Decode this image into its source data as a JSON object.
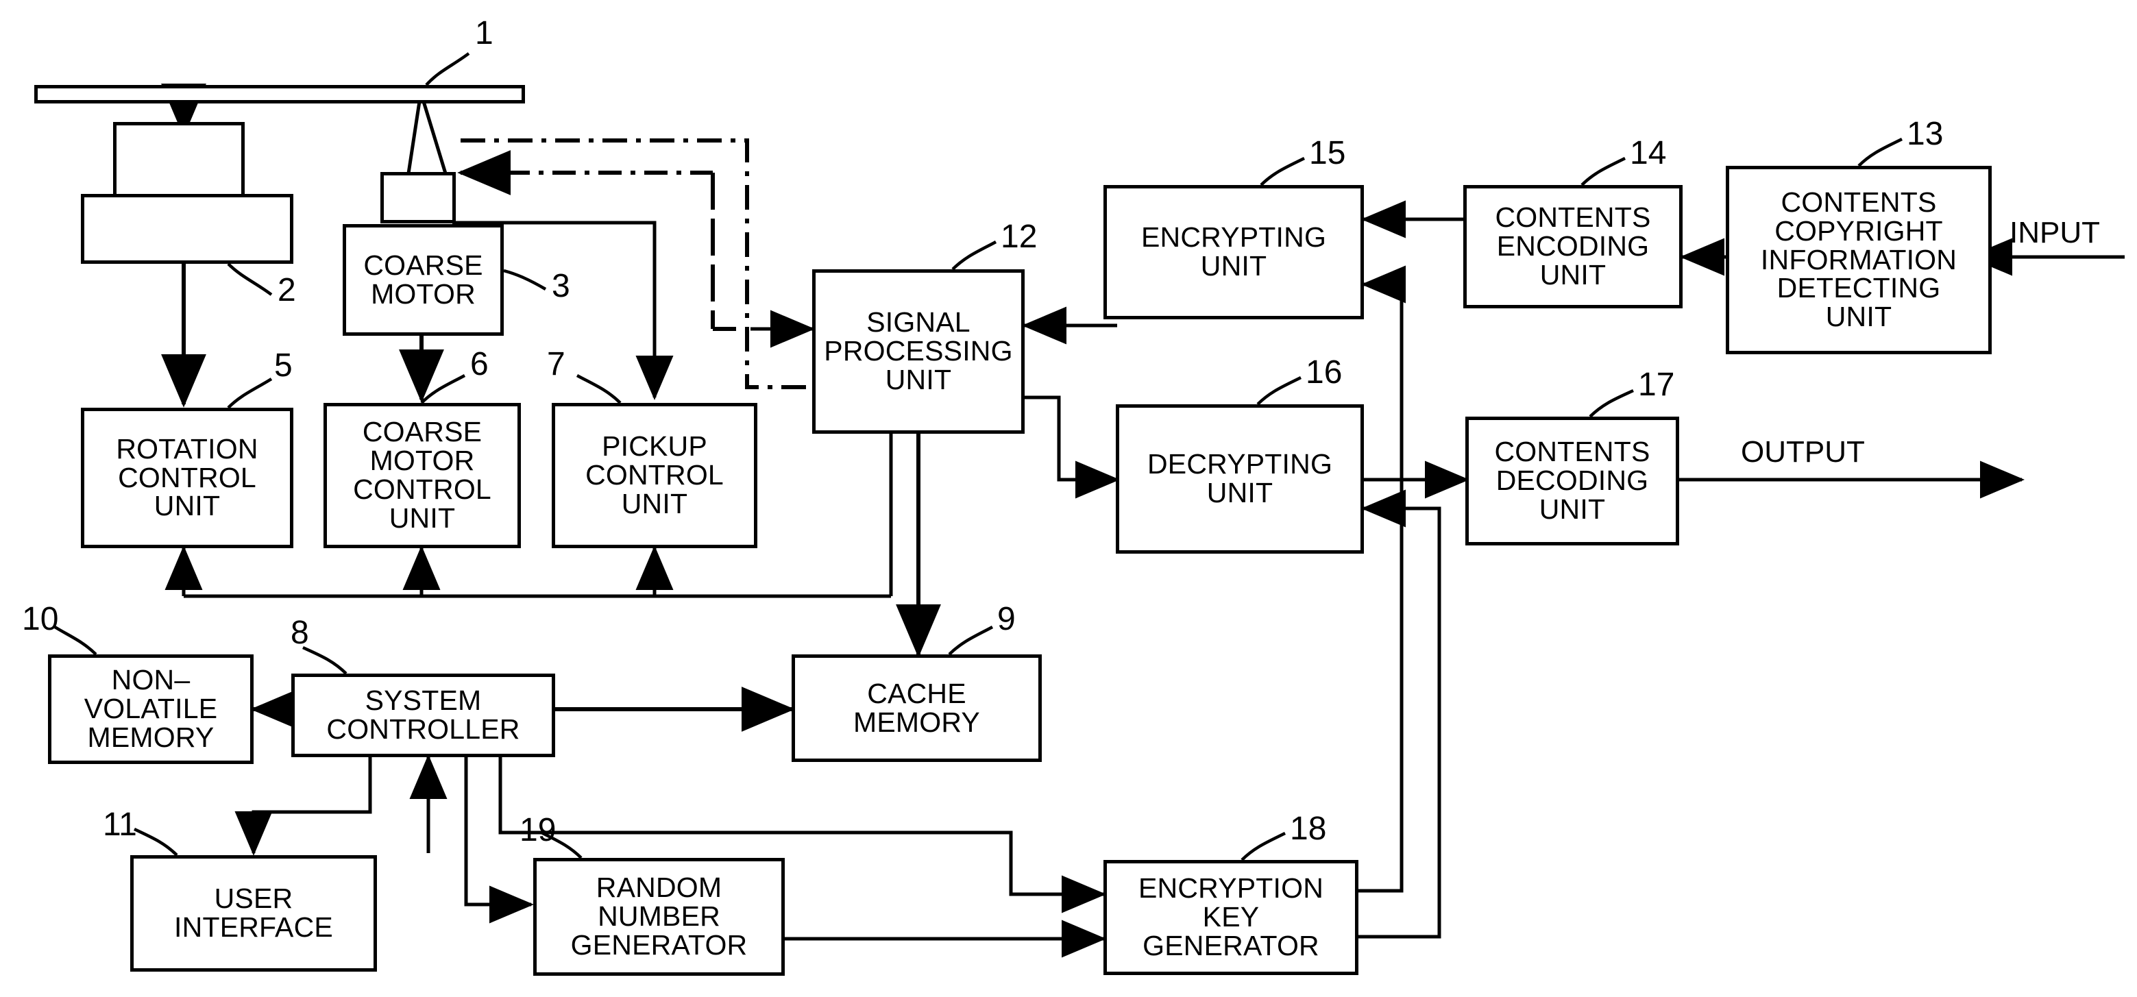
{
  "figure": {
    "type": "patent-block-diagram",
    "title": "Optical disc recording/reproducing apparatus with content encryption block diagram"
  },
  "blocks": [
    {
      "id": "disc",
      "ref": "1",
      "label": "",
      "lines": []
    },
    {
      "id": "spindle-motor",
      "ref": "2",
      "label": "",
      "lines": []
    },
    {
      "id": "coarse-motor",
      "ref": "3",
      "label": "COARSE MOTOR",
      "lines": [
        "COARSE",
        "MOTOR"
      ]
    },
    {
      "id": "rotation-control-unit",
      "ref": "5",
      "label": "ROTATION CONTROL UNIT",
      "lines": [
        "ROTATION",
        "CONTROL",
        "UNIT"
      ]
    },
    {
      "id": "coarse-motor-control-unit",
      "ref": "6",
      "label": "COARSE MOTOR CONTROL UNIT",
      "lines": [
        "COARSE",
        "MOTOR",
        "CONTROL",
        "UNIT"
      ]
    },
    {
      "id": "pickup-control-unit",
      "ref": "7",
      "label": "PICKUP CONTROL UNIT",
      "lines": [
        "PICKUP",
        "CONTROL",
        "UNIT"
      ]
    },
    {
      "id": "system-controller",
      "ref": "8",
      "label": "SYSTEM CONTROLLER",
      "lines": [
        "SYSTEM",
        "CONTROLLER"
      ]
    },
    {
      "id": "cache-memory",
      "ref": "9",
      "label": "CACHE MEMORY",
      "lines": [
        "CACHE",
        "MEMORY"
      ]
    },
    {
      "id": "non-volatile-memory",
      "ref": "10",
      "label": "NON-VOLATILE MEMORY",
      "lines": [
        "NON–",
        "VOLATILE",
        "MEMORY"
      ]
    },
    {
      "id": "user-interface",
      "ref": "11",
      "label": "USER INTERFACE",
      "lines": [
        "USER",
        "INTERFACE"
      ]
    },
    {
      "id": "signal-processing-unit",
      "ref": "12",
      "label": "SIGNAL PROCESSING UNIT",
      "lines": [
        "SIGNAL",
        "PROCESSING",
        "UNIT"
      ]
    },
    {
      "id": "contents-copyright-information-detecting-unit",
      "ref": "13",
      "label": "CONTENTS COPYRIGHT INFORMATION DETECTING UNIT",
      "lines": [
        "CONTENTS",
        "COPYRIGHT",
        "INFORMATION",
        "DETECTING",
        "UNIT"
      ]
    },
    {
      "id": "contents-encoding-unit",
      "ref": "14",
      "label": "CONTENTS ENCODING UNIT",
      "lines": [
        "CONTENTS",
        "ENCODING",
        "UNIT"
      ]
    },
    {
      "id": "encrypting-unit",
      "ref": "15",
      "label": "ENCRYPTING UNIT",
      "lines": [
        "ENCRYPTING",
        "UNIT"
      ]
    },
    {
      "id": "decrypting-unit",
      "ref": "16",
      "label": "DECRYPTING UNIT",
      "lines": [
        "DECRYPTING",
        "UNIT"
      ]
    },
    {
      "id": "contents-decoding-unit",
      "ref": "17",
      "label": "CONTENTS DECODING UNIT",
      "lines": [
        "CONTENTS",
        "DECODING",
        "UNIT"
      ]
    },
    {
      "id": "encryption-key-generator",
      "ref": "18",
      "label": "ENCRYPTION KEY GENERATOR",
      "lines": [
        "ENCRYPTION",
        "KEY",
        "GENERATOR"
      ]
    },
    {
      "id": "random-number-generator",
      "ref": "19",
      "label": "RANDOM NUMBER GENERATOR",
      "lines": [
        "RANDOM",
        "NUMBER",
        "GENERATOR"
      ]
    }
  ],
  "reference_numerals": {
    "n1": "1",
    "n2": "2",
    "n3": "3",
    "n5": "5",
    "n6": "6",
    "n7": "7",
    "n8": "8",
    "n9": "9",
    "n10": "10",
    "n11": "11",
    "n12": "12",
    "n13": "13",
    "n14": "14",
    "n15": "15",
    "n16": "16",
    "n17": "17",
    "n18": "18",
    "n19": "19"
  },
  "io_labels": {
    "input": "INPUT",
    "output": "OUTPUT"
  },
  "block_text": {
    "coarse_motor": {
      "l1": "COARSE",
      "l2": "MOTOR"
    },
    "rotation_control_unit": {
      "l1": "ROTATION",
      "l2": "CONTROL",
      "l3": "UNIT"
    },
    "coarse_motor_control_unit": {
      "l1": "COARSE",
      "l2": "MOTOR",
      "l3": "CONTROL",
      "l4": "UNIT"
    },
    "pickup_control_unit": {
      "l1": "PICKUP",
      "l2": "CONTROL",
      "l3": "UNIT"
    },
    "system_controller": {
      "l1": "SYSTEM",
      "l2": "CONTROLLER"
    },
    "cache_memory": {
      "l1": "CACHE",
      "l2": "MEMORY"
    },
    "non_volatile_memory": {
      "l1": "NON–",
      "l2": "VOLATILE",
      "l3": "MEMORY"
    },
    "user_interface": {
      "l1": "USER",
      "l2": "INTERFACE"
    },
    "signal_processing_unit": {
      "l1": "SIGNAL",
      "l2": "PROCESSING",
      "l3": "UNIT"
    },
    "contents_copyright_information_detecting_unit": {
      "l1": "CONTENTS",
      "l2": "COPYRIGHT",
      "l3": "INFORMATION",
      "l4": "DETECTING",
      "l5": "UNIT"
    },
    "contents_encoding_unit": {
      "l1": "CONTENTS",
      "l2": "ENCODING",
      "l3": "UNIT"
    },
    "encrypting_unit": {
      "l1": "ENCRYPTING",
      "l2": "UNIT"
    },
    "decrypting_unit": {
      "l1": "DECRYPTING",
      "l2": "UNIT"
    },
    "contents_decoding_unit": {
      "l1": "CONTENTS",
      "l2": "DECODING",
      "l3": "UNIT"
    },
    "encryption_key_generator": {
      "l1": "ENCRYPTION",
      "l2": "KEY",
      "l3": "GENERATOR"
    },
    "random_number_generator": {
      "l1": "RANDOM",
      "l2": "NUMBER",
      "l3": "GENERATOR"
    }
  },
  "colors": {
    "line": "#000000",
    "fill": "#ffffff"
  }
}
